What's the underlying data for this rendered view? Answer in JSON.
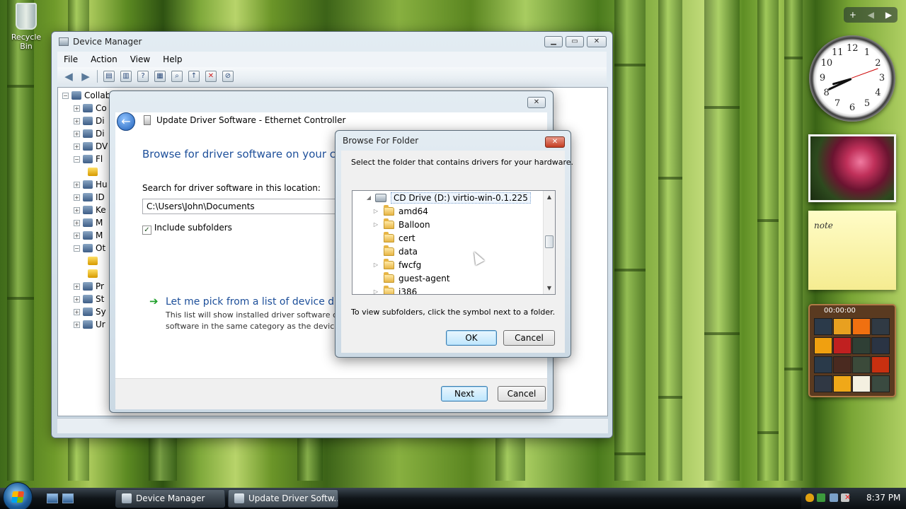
{
  "desktop": {
    "recycle_bin_label": "Recycle Bin"
  },
  "device_manager": {
    "title": "Device Manager",
    "menu": [
      "File",
      "Action",
      "View",
      "Help"
    ],
    "tree": [
      {
        "label": "Collab",
        "expander": "−"
      },
      {
        "label": "Co",
        "expander": "+"
      },
      {
        "label": "Di",
        "expander": "+"
      },
      {
        "label": "Di",
        "expander": "+"
      },
      {
        "label": "DV",
        "expander": "+"
      },
      {
        "label": "Fl",
        "expander": "−"
      },
      {
        "label": "",
        "expander": ""
      },
      {
        "label": "Hu",
        "expander": "+"
      },
      {
        "label": "ID",
        "expander": "+"
      },
      {
        "label": "Ke",
        "expander": "+"
      },
      {
        "label": "M",
        "expander": "+"
      },
      {
        "label": "M",
        "expander": "+"
      },
      {
        "label": "Ot",
        "expander": "−"
      },
      {
        "label": "",
        "expander": ""
      },
      {
        "label": "",
        "expander": ""
      },
      {
        "label": "Pr",
        "expander": "+"
      },
      {
        "label": "St",
        "expander": "+"
      },
      {
        "label": "Sy",
        "expander": "+"
      },
      {
        "label": "Ur",
        "expander": "+"
      }
    ]
  },
  "update_driver": {
    "title": "Update Driver Software - Ethernet Controller",
    "heading": "Browse for driver software on your com",
    "search_label": "Search for driver software in this location:",
    "path_value": "C:\\Users\\John\\Documents",
    "include_subfolders_label": "Include subfolders",
    "include_subfolders_checked": true,
    "pick_link": "Let me pick from a list of device dri",
    "pick_desc_line1": "This list will show installed driver software cor",
    "pick_desc_line2": "software in the same category as the device.",
    "next_label": "Next",
    "cancel_label": "Cancel"
  },
  "browse_folder": {
    "title": "Browse For Folder",
    "instruction": "Select the folder that contains drivers for your hardware.",
    "drive_label": "CD Drive (D:) virtio-win-0.1.225",
    "folders": [
      {
        "name": "amd64",
        "expandable": true
      },
      {
        "name": "Balloon",
        "expandable": true
      },
      {
        "name": "cert",
        "expandable": false
      },
      {
        "name": "data",
        "expandable": false
      },
      {
        "name": "fwcfg",
        "expandable": true
      },
      {
        "name": "guest-agent",
        "expandable": false
      },
      {
        "name": "i386",
        "expandable": true
      }
    ],
    "hint": "To view subfolders, click the symbol next to a folder.",
    "ok_label": "OK",
    "cancel_label": "Cancel"
  },
  "gadgets": {
    "clock_numbers": [
      "12",
      "1",
      "2",
      "3",
      "4",
      "5",
      "6",
      "7",
      "8",
      "9",
      "10",
      "11"
    ],
    "note_text": "note",
    "puzzle_timer": "00:00:00"
  },
  "taskbar": {
    "items": [
      {
        "label": "Device Manager",
        "active": false
      },
      {
        "label": "Update Driver Softw...",
        "active": true
      }
    ],
    "clock": "8:37 PM"
  }
}
